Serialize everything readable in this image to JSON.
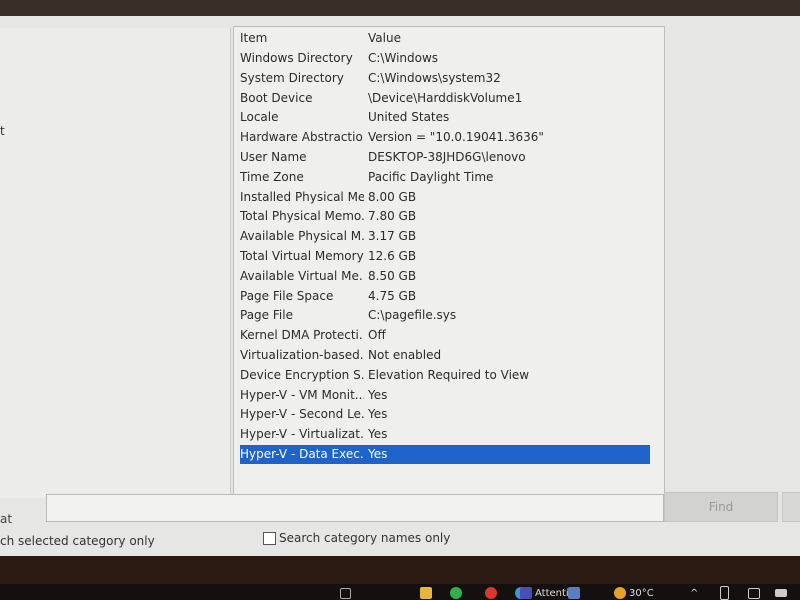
{
  "left_pane": {
    "fragment": "t"
  },
  "list": {
    "headers": {
      "item": "Item",
      "value": "Value"
    },
    "rows": [
      {
        "item": "Windows Directory",
        "value": "C:\\Windows"
      },
      {
        "item": "System Directory",
        "value": "C:\\Windows\\system32"
      },
      {
        "item": "Boot Device",
        "value": "\\Device\\HarddiskVolume1"
      },
      {
        "item": "Locale",
        "value": "United States"
      },
      {
        "item": "Hardware Abstractio...",
        "value": "Version = \"10.0.19041.3636\""
      },
      {
        "item": "User Name",
        "value": "DESKTOP-38JHD6G\\lenovo"
      },
      {
        "item": "Time Zone",
        "value": "Pacific Daylight Time"
      },
      {
        "item": "Installed Physical Me...",
        "value": "8.00 GB"
      },
      {
        "item": "Total Physical Memo...",
        "value": "7.80 GB"
      },
      {
        "item": "Available Physical M...",
        "value": "3.17 GB"
      },
      {
        "item": "Total Virtual Memory",
        "value": "12.6 GB"
      },
      {
        "item": "Available Virtual Me...",
        "value": "8.50 GB"
      },
      {
        "item": "Page File Space",
        "value": "4.75 GB"
      },
      {
        "item": "Page File",
        "value": "C:\\pagefile.sys"
      },
      {
        "item": "Kernel DMA Protecti...",
        "value": "Off"
      },
      {
        "item": "Virtualization-based...",
        "value": "Not enabled"
      },
      {
        "item": "Device Encryption S...",
        "value": "Elevation Required to View"
      },
      {
        "item": "Hyper-V - VM Monit...",
        "value": "Yes"
      },
      {
        "item": "Hyper-V - Second Le...",
        "value": "Yes"
      },
      {
        "item": "Hyper-V - Virtualizat...",
        "value": "Yes"
      },
      {
        "item": "Hyper-V - Data Exec...",
        "value": "Yes",
        "selected": true
      }
    ]
  },
  "find": {
    "label": "at",
    "value": "",
    "button": "Find"
  },
  "options": {
    "selected_only": "ch selected category only",
    "names_only": "Search category names only",
    "names_only_checked": false
  },
  "taskbar": {
    "app_label": "Attenti",
    "temperature": "30°C"
  },
  "colors": {
    "selection": "#1e63c9"
  }
}
